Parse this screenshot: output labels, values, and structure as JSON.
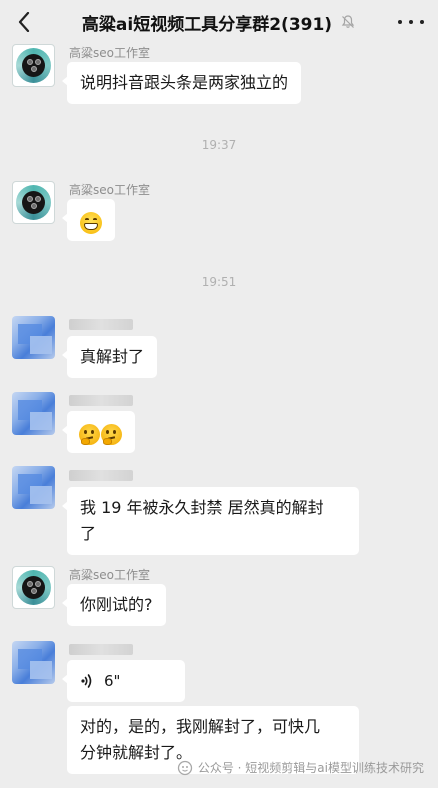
{
  "header": {
    "title": "高粱ai短视频工具分享群2(391)",
    "back_icon": "chevron-left-icon",
    "mute_icon": "bell-muted-icon",
    "more_icon": "more-dots-icon"
  },
  "messages": {
    "m1": {
      "sender": "高粱seo工作室",
      "text": "说明抖音跟头条是两家独立的"
    },
    "t1": "19:37",
    "m2": {
      "sender": "高粱seo工作室",
      "emoji": "grinning-face-icon"
    },
    "t2": "19:51",
    "m3": {
      "text": "真解封了"
    },
    "m4": {
      "emoji": "thinking-face-icon"
    },
    "m5": {
      "text_line1": "我 19 年被永久封禁 居然真的解封",
      "text_line2": "了"
    },
    "m6": {
      "sender": "高粱seo工作室",
      "text": "你刚试的?"
    },
    "m7": {
      "voice_duration": "6\""
    },
    "m8": {
      "text_line1": "对的，是的，我刚解封了，可快几",
      "text_line2": "分钟就解封了。"
    }
  },
  "watermark": {
    "text": "公众号 · 短视频剪辑与ai模型训练技术研究",
    "icon": "wechat-official-account-icon"
  },
  "colors": {
    "background": "#ededed",
    "bubble": "#ffffff",
    "sender_text": "#8e8e8e",
    "time_text": "#b0b0b0"
  }
}
